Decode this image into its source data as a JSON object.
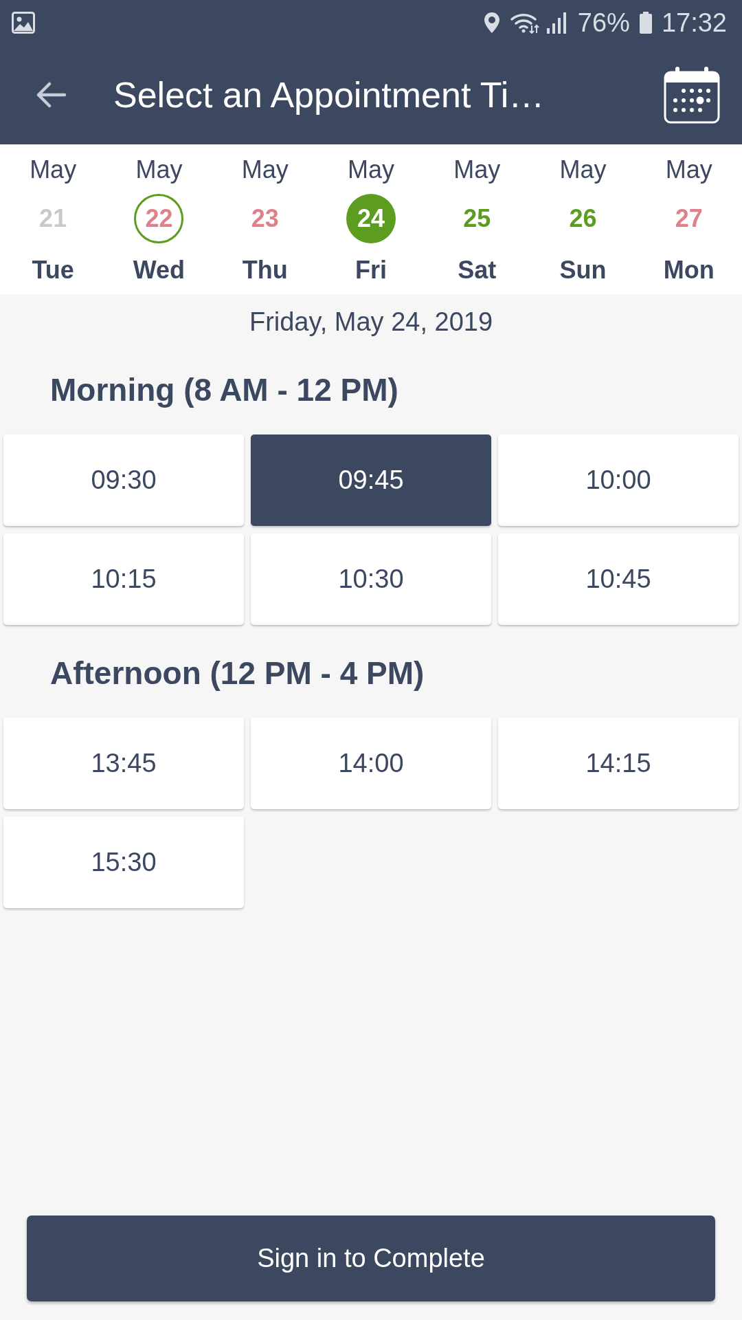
{
  "status_bar": {
    "battery": "76%",
    "time": "17:32"
  },
  "header": {
    "title": "Select an Appointment Ti…"
  },
  "days": [
    {
      "month": "May",
      "date": "21",
      "weekday": "Tue",
      "color": "#c9c9c9",
      "today": false,
      "selected": false
    },
    {
      "month": "May",
      "date": "22",
      "weekday": "Wed",
      "color": "#e0808b",
      "today": true,
      "selected": false
    },
    {
      "month": "May",
      "date": "23",
      "weekday": "Thu",
      "color": "#e0808b",
      "today": false,
      "selected": false
    },
    {
      "month": "May",
      "date": "24",
      "weekday": "Fri",
      "color": "#5c9c20",
      "today": false,
      "selected": true
    },
    {
      "month": "May",
      "date": "25",
      "weekday": "Sat",
      "color": "#5c9c20",
      "today": false,
      "selected": false
    },
    {
      "month": "May",
      "date": "26",
      "weekday": "Sun",
      "color": "#5c9c20",
      "today": false,
      "selected": false
    },
    {
      "month": "May",
      "date": "27",
      "weekday": "Mon",
      "color": "#e0808b",
      "today": false,
      "selected": false
    }
  ],
  "selected_date": "Friday, May 24, 2019",
  "sections": [
    {
      "title": "Morning (8 AM - 12 PM)",
      "slots": [
        {
          "time": "09:30",
          "selected": false
        },
        {
          "time": "09:45",
          "selected": true
        },
        {
          "time": "10:00",
          "selected": false
        },
        {
          "time": "10:15",
          "selected": false
        },
        {
          "time": "10:30",
          "selected": false
        },
        {
          "time": "10:45",
          "selected": false
        }
      ]
    },
    {
      "title": "Afternoon (12 PM - 4 PM)",
      "slots": [
        {
          "time": "13:45",
          "selected": false
        },
        {
          "time": "14:00",
          "selected": false
        },
        {
          "time": "14:15",
          "selected": false
        },
        {
          "time": "15:30",
          "selected": false
        }
      ]
    }
  ],
  "action_button": {
    "label": "Sign in to Complete"
  }
}
